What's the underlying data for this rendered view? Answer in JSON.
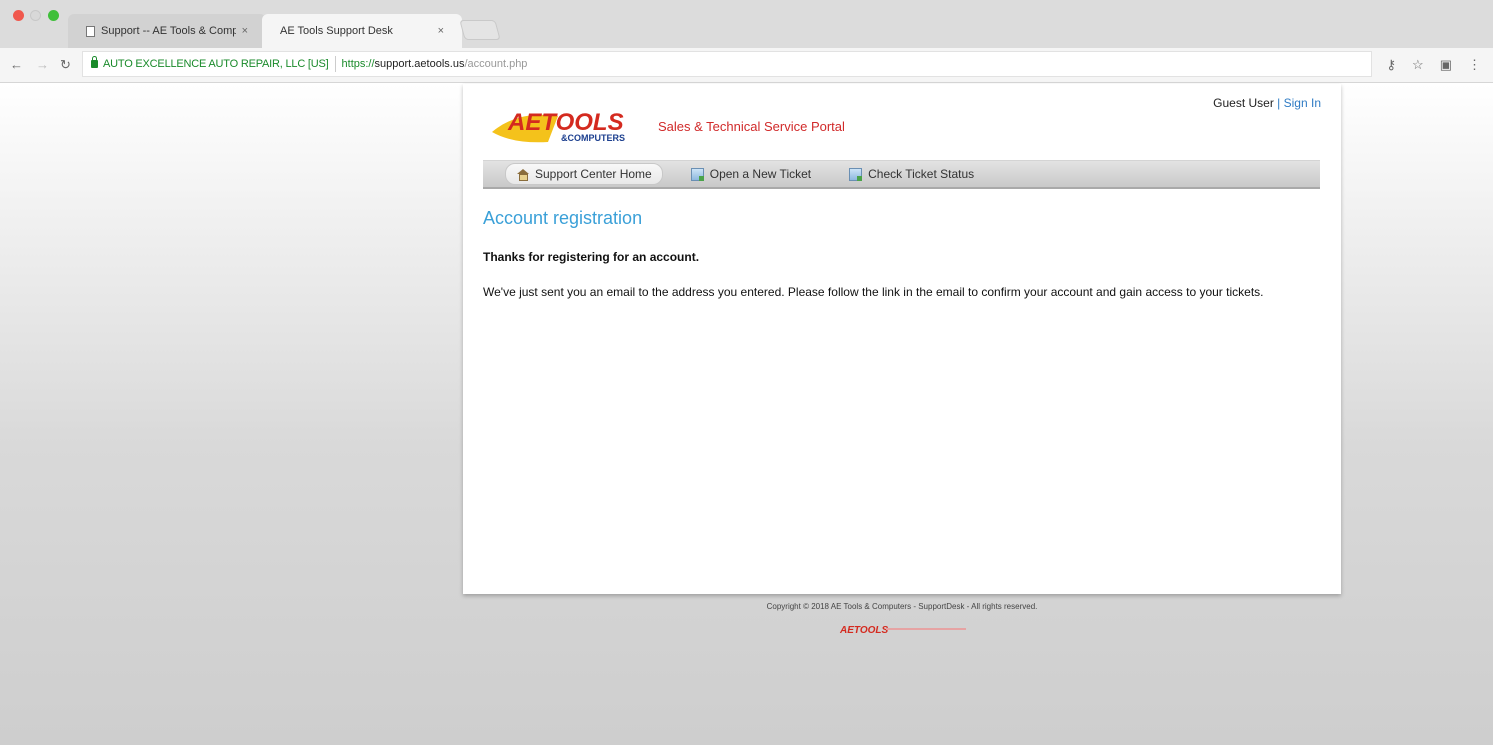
{
  "browser": {
    "tabs": [
      {
        "title": "Support -- AE Tools & Compu",
        "active": false
      },
      {
        "title": "AE Tools Support Desk",
        "active": true
      }
    ],
    "tab_close_glyph": "×",
    "address": {
      "ev_name": "AUTO EXCELLENCE AUTO REPAIR, LLC [US]",
      "scheme": "https://",
      "host": "support.aetools.us",
      "path": "/account.php"
    },
    "toolbar_icons": [
      "key-icon",
      "star-icon",
      "cast-icon",
      "menu-icon"
    ]
  },
  "site": {
    "logo_text": "AETOOLS",
    "logo_sub": "&COMPUTERS",
    "tagline": "Sales & Technical Service Portal",
    "user_label": "Guest User",
    "user_sep": "|",
    "signin_label": "Sign In",
    "nav": [
      {
        "label": "Support Center Home",
        "icon": "home-icon",
        "active": true
      },
      {
        "label": "Open a New Ticket",
        "icon": "new-ticket-icon",
        "active": false
      },
      {
        "label": "Check Ticket Status",
        "icon": "ticket-status-icon",
        "active": false
      }
    ]
  },
  "main": {
    "title": "Account registration",
    "lead": "Thanks for registering for an account.",
    "body": "We've just sent you an email to the address you entered. Please follow the link in the email to confirm your account and gain access to your tickets."
  },
  "footer": {
    "copyright": "Copyright © 2018 AE Tools & Computers - SupportDesk - All rights reserved."
  },
  "colors": {
    "accent_blue": "#3aa0d8",
    "link_blue": "#2e7bc4",
    "brand_red": "#d12a2a",
    "secure_green": "#198a2a"
  }
}
